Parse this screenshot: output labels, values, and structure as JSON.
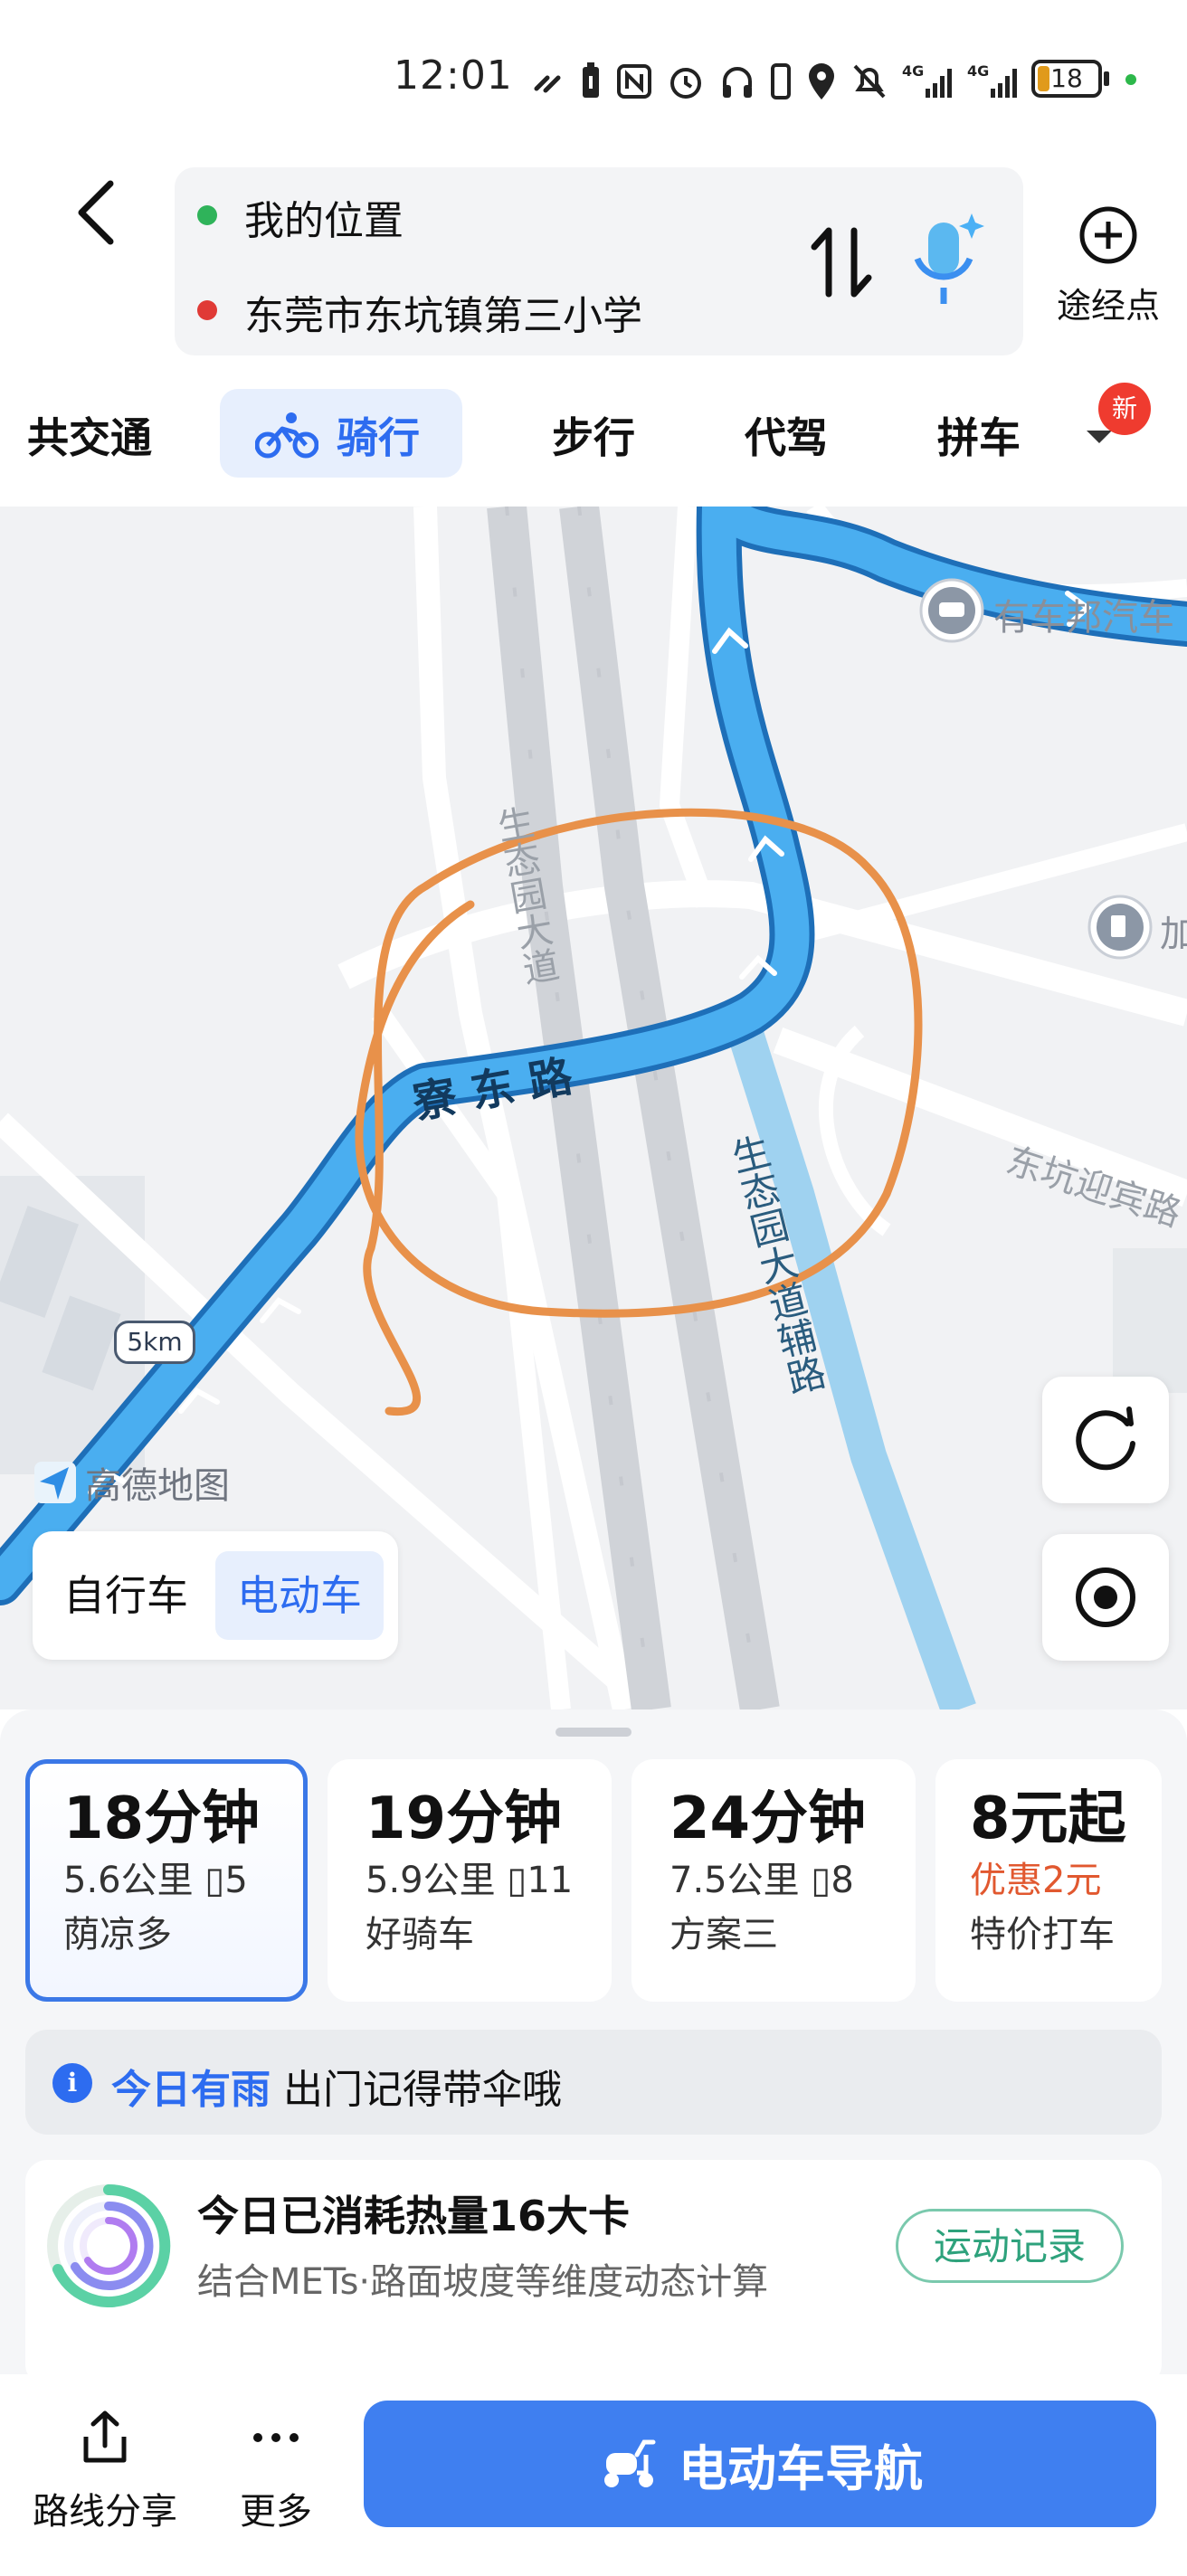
{
  "status_bar": {
    "time": "12:01",
    "battery_level": "18",
    "network": [
      "4G",
      "4G"
    ],
    "icons": [
      "link-icon",
      "battery-saver-icon",
      "nfc-icon",
      "alarm-icon",
      "headphones-icon",
      "vibrate-icon",
      "location-icon",
      "mute-icon",
      "signal-4g-icon",
      "signal-4g-icon",
      "battery-icon"
    ]
  },
  "header": {
    "origin": "我的位置",
    "destination": "东莞市东坑镇第三小学",
    "origin_dot_color": "#2fb35a",
    "destination_dot_color": "#e03a36",
    "waypoint_label": "途经点"
  },
  "tabs": {
    "items": [
      {
        "label": "共交通"
      },
      {
        "label": "骑行"
      },
      {
        "label": "步行"
      },
      {
        "label": "代驾"
      },
      {
        "label": "拼车"
      }
    ],
    "active_index": 1,
    "badge": "新"
  },
  "map": {
    "road_labels": {
      "liaodong": "寮 东 路",
      "shengtaiyuan": "生态园大道",
      "fulu": "生态园大道辅路",
      "dongkeng": "东坑迎宾路",
      "poi_car": "有车邦汽车",
      "poi_gas": "加"
    },
    "scale": "5km",
    "logo": "高德地图",
    "route_color": "#3ea2ea",
    "annotation_color": "#e8914a",
    "vehicle_options": [
      "自行车",
      "电动车"
    ],
    "vehicle_active": 1
  },
  "routes": [
    {
      "time": "18分钟",
      "distance": "5.6公里",
      "lights": "5",
      "tag": "荫凉多",
      "selected": true
    },
    {
      "time": "19分钟",
      "distance": "5.9公里",
      "lights": "11",
      "tag": "好骑车",
      "selected": false
    },
    {
      "time": "24分钟",
      "distance": "7.5公里",
      "lights": "8",
      "tag": "方案三",
      "selected": false
    }
  ],
  "taxi": {
    "price": "8元起",
    "discount": "优惠2元",
    "label": "特价打车"
  },
  "tip": {
    "highlight": "今日有雨",
    "text": "出门记得带伞哦"
  },
  "calories": {
    "title": "今日已消耗热量16大卡",
    "subtitle": "结合METs·路面坡度等维度动态计算",
    "button": "运动记录"
  },
  "bottom": {
    "share": "路线分享",
    "more": "更多",
    "nav": "电动车导航"
  }
}
